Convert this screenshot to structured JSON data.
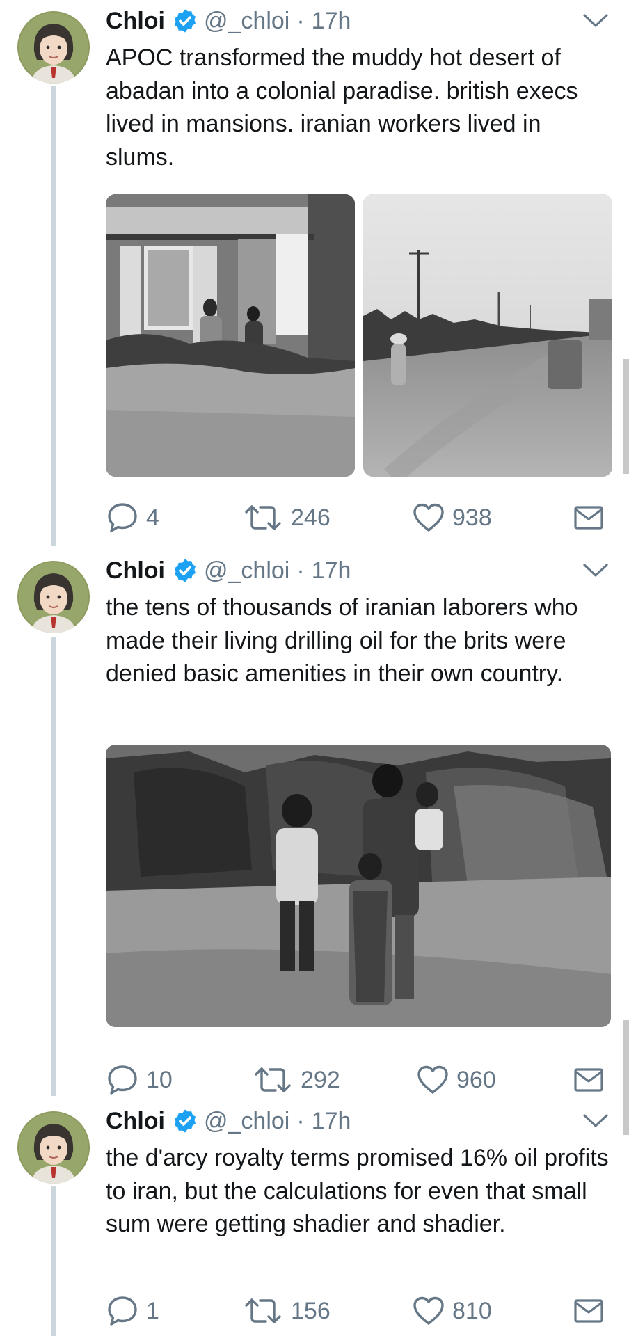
{
  "tweets": [
    {
      "name": "Chloi",
      "handle": "@_chloi",
      "separator": "·",
      "time": "17h",
      "text": "APOC transformed the muddy hot desert of abadan into a colonial paradise. british execs lived in mansions. iranian workers lived in slums.",
      "media_count": 2,
      "replies": "4",
      "retweets": "246",
      "likes": "938"
    },
    {
      "name": "Chloi",
      "handle": "@_chloi",
      "separator": "·",
      "time": "17h",
      "text": "the tens of thousands of iranian laborers who made their living drilling oil for the brits were denied basic amenities in their own country.",
      "media_count": 1,
      "replies": "10",
      "retweets": "292",
      "likes": "960"
    },
    {
      "name": "Chloi",
      "handle": "@_chloi",
      "separator": "·",
      "time": "17h",
      "text": "the d'arcy royalty terms promised 16% oil profits to iran, but the calculations for even that small sum were getting shadier and shadier.",
      "media_count": 0,
      "replies": "1",
      "retweets": "156",
      "likes": "810"
    }
  ],
  "icons": {
    "verified": "verified-badge-icon",
    "chevron": "chevron-down-icon",
    "reply": "reply-icon",
    "retweet": "retweet-icon",
    "like": "heart-icon",
    "dm": "envelope-icon"
  },
  "colors": {
    "verified": "#1da1f2",
    "secondary_text": "#657786",
    "thread_line": "#ccd6dd"
  }
}
